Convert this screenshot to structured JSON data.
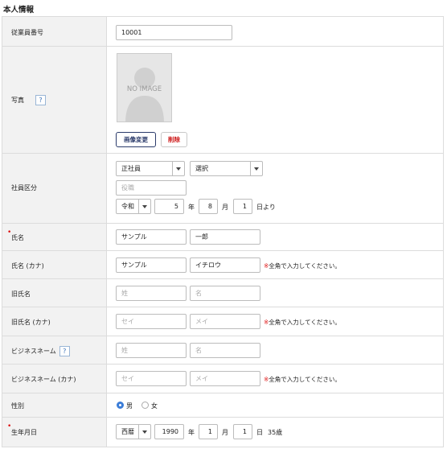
{
  "section_title": "本人情報",
  "labels": {
    "employee_number": "従業員番号",
    "photo": "写真",
    "employee_type": "社員区分",
    "name": "氏名",
    "name_kana": "氏名 (カナ)",
    "former_name": "旧氏名",
    "former_name_kana": "旧氏名 (カナ)",
    "business_name": "ビジネスネーム",
    "business_name_kana": "ビジネスネーム (カナ)",
    "gender": "性別",
    "birthdate": "生年月日"
  },
  "help_mark": "?",
  "employee_number": {
    "value": "10001"
  },
  "photo": {
    "placeholder_text": "NO IMAGE",
    "change_button": "画像変更",
    "delete_button": "削除"
  },
  "employee_type": {
    "type_select": "正社員",
    "sub_select": "選択",
    "position_placeholder": "役職",
    "era_select": "令和",
    "year": "5",
    "year_unit": "年",
    "month": "8",
    "month_unit": "月",
    "day": "1",
    "day_suffix": "日より"
  },
  "name": {
    "last": "サンプル",
    "first": "一郎"
  },
  "name_kana": {
    "last": "サンプル",
    "first": "イチロウ"
  },
  "fullwidth_note": {
    "mark": "※",
    "text": "全角で入力してください。"
  },
  "former_name": {
    "last_placeholder": "姓",
    "first_placeholder": "名"
  },
  "former_name_kana": {
    "last_placeholder": "セイ",
    "first_placeholder": "メイ"
  },
  "business_name": {
    "last_placeholder": "姓",
    "first_placeholder": "名"
  },
  "business_name_kana": {
    "last_placeholder": "セイ",
    "first_placeholder": "メイ"
  },
  "gender": {
    "options": [
      "男",
      "女"
    ],
    "selected": "男"
  },
  "birthdate": {
    "calendar_select": "西暦",
    "year": "1990",
    "year_unit": "年",
    "month": "1",
    "month_unit": "月",
    "day": "1",
    "day_unit": "日",
    "age": "35歳"
  },
  "colors": {
    "required_mark": "#dd1111",
    "note_mark": "#e02020",
    "radio_selected": "#3b7dd8",
    "label_bg": "#f2f2f2"
  }
}
